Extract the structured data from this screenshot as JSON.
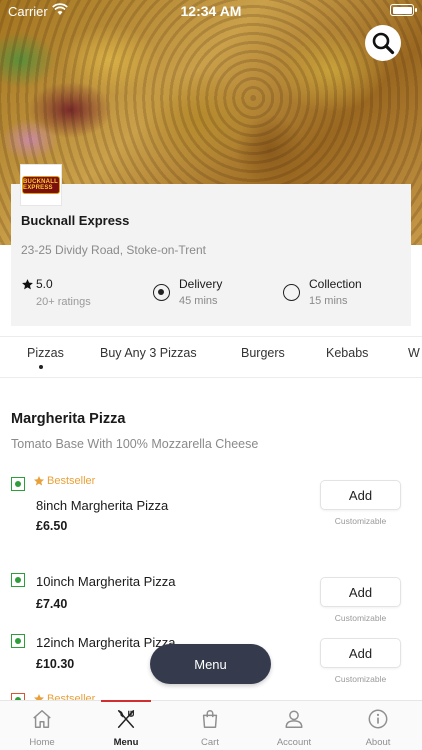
{
  "status_bar": {
    "carrier": "Carrier",
    "time": "12:34 AM"
  },
  "restaurant": {
    "logo_text": "BUCKNALL EXPRESS",
    "name": "Bucknall Express",
    "address": "23-25 Dividy Road, Stoke-on-Trent",
    "rating": "5.0",
    "rating_count": "20+ ratings",
    "options": [
      {
        "label": "Delivery",
        "time": "45 mins",
        "selected": true
      },
      {
        "label": "Collection",
        "time": "15 mins",
        "selected": false
      }
    ]
  },
  "category_tabs": [
    "Pizzas",
    "Buy Any 3 Pizzas",
    "Burgers",
    "Kebabs",
    "W"
  ],
  "active_tab": "Pizzas",
  "section": {
    "title": "Margherita  Pizza",
    "description": "Tomato Base With 100% Mozzarella Cheese"
  },
  "items": [
    {
      "badge": "Bestseller",
      "name": "8inch Margherita  Pizza",
      "price": "£6.50",
      "button": "Add",
      "note": "Customizable"
    },
    {
      "badge": "",
      "name": "10inch Margherita  Pizza",
      "price": "£7.40",
      "button": "Add",
      "note": "Customizable"
    },
    {
      "badge": "",
      "name": "12inch Margherita  Pizza",
      "price": "£10.30",
      "button": "Add",
      "note": "Customizable"
    },
    {
      "badge": "Bestseller"
    }
  ],
  "floating_menu_label": "Menu",
  "bottom_nav": [
    {
      "label": "Home",
      "icon": "home-icon",
      "active": false
    },
    {
      "label": "Menu",
      "icon": "fork-knife-icon",
      "active": true
    },
    {
      "label": "Cart",
      "icon": "bag-icon",
      "active": false
    },
    {
      "label": "Account",
      "icon": "user-icon",
      "active": false
    },
    {
      "label": "About",
      "icon": "info-icon",
      "active": false
    }
  ],
  "colors": {
    "accent": "#d12f2f",
    "veg": "#2e9e3a",
    "bestseller": "#e8a13a",
    "pill": "#353b4d"
  }
}
